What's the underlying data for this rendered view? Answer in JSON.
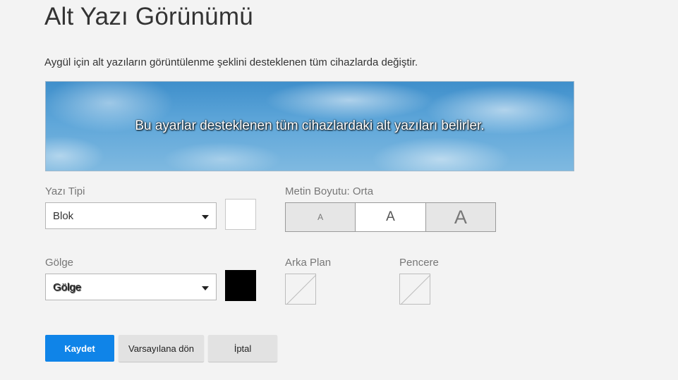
{
  "page": {
    "title": "Alt Yazı Görünümü",
    "description": "Aygül için alt yazıların görüntülenme şeklini desteklenen tüm cihazlarda değiştir."
  },
  "preview": {
    "text": "Bu ayarlar desteklenen tüm cihazlardaki alt yazıları belirler."
  },
  "font": {
    "label": "Yazı Tipi",
    "selected": "Blok",
    "color": "#ffffff"
  },
  "text_size": {
    "label": "Metin Boyutu: Orta",
    "options": [
      "A",
      "A",
      "A"
    ],
    "selected_index": 1
  },
  "shadow": {
    "label": "Gölge",
    "selected": "Gölge",
    "color": "#000000"
  },
  "background": {
    "label": "Arka Plan"
  },
  "window": {
    "label": "Pencere"
  },
  "buttons": {
    "save": "Kaydet",
    "reset": "Varsayılana dön",
    "cancel": "İptal"
  },
  "colors": {
    "accent": "#0f84e8"
  }
}
